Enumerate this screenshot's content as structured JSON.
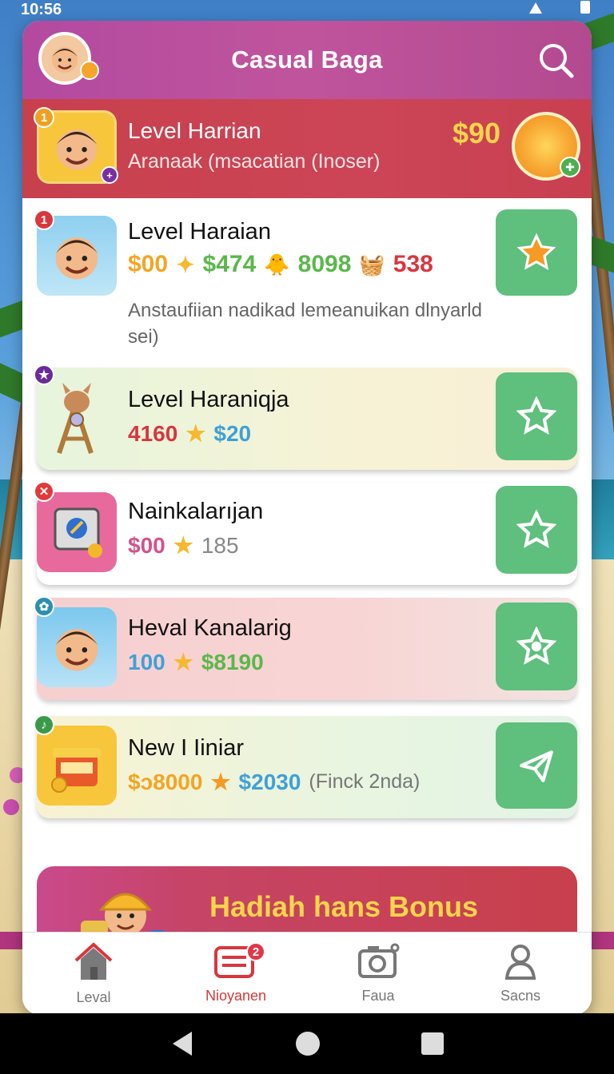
{
  "status": {
    "time": "10:56"
  },
  "header": {
    "title": "Casual Baga"
  },
  "banner": {
    "badge": "1",
    "title": "Level Harrian",
    "subtitle": "Aranaak (msacatian (Inoser)",
    "price": "$90"
  },
  "items": [
    {
      "badge": "1",
      "name": "Level Haraian",
      "stats": [
        "$00",
        "$474",
        "8098",
        "538"
      ],
      "desc": "Anstaufiian nadikad lemeanuikan dlnyarld sei)"
    },
    {
      "badge": "★",
      "name": "Level Haraniqja",
      "stats": [
        "4160",
        "$20"
      ]
    },
    {
      "badge": "✕",
      "name": "Nainkalarıjan",
      "stats": [
        "$00",
        "185"
      ]
    },
    {
      "badge": "✿",
      "name": "Heval Kanalarig",
      "stats": [
        "100",
        "$8190"
      ]
    },
    {
      "badge": "♪",
      "name": "New I Iiniar",
      "stats": [
        "$ɔ8000",
        "$2030",
        "(Finck 2nda)"
      ]
    }
  ],
  "bonus": {
    "label": "Hadiah hans Bonus"
  },
  "tabs": [
    {
      "label": "Leval",
      "icon": "home-icon"
    },
    {
      "label": "Nioyanen",
      "icon": "list-card-icon",
      "badge": "2"
    },
    {
      "label": "Faua",
      "icon": "camera-icon"
    },
    {
      "label": "Sacns",
      "icon": "person-icon"
    }
  ],
  "colors": {
    "header": "#b34aa0",
    "banner": "#c8404c",
    "fav": "#5fbf7d",
    "price_gold": "#ffd54a"
  }
}
